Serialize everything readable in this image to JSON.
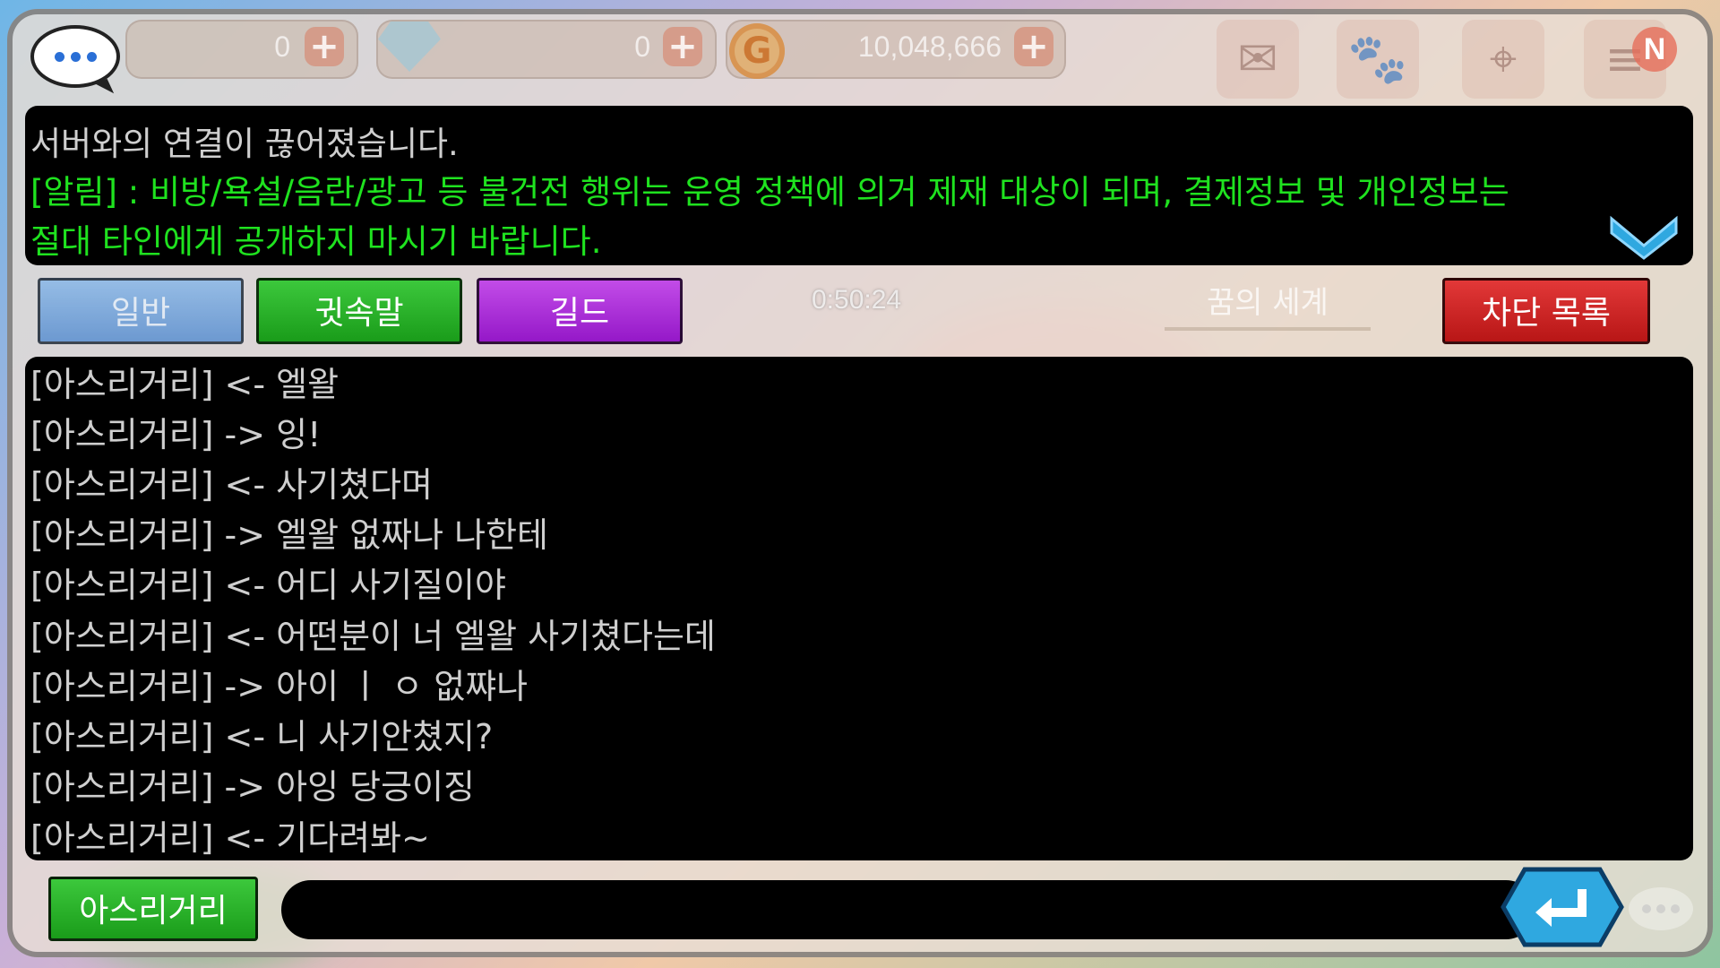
{
  "currency": {
    "slot1_value": "0",
    "slot2_value": "0",
    "gold_value": "10,048,666",
    "plus_glyph": "+",
    "coin_glyph": "G"
  },
  "top_icons": {
    "mail": "✉",
    "paw": "🐾",
    "map_pin": "⌖",
    "list": "≡",
    "new_badge": "N"
  },
  "notice": {
    "system_message": "서버와의 연결이 끊어졌습니다.",
    "warning_line1": "[알림] : 비방/욕설/음란/광고 등 불건전 행위는 운영 정책에 의거 제재 대상이 되며, 결제정보 및 개인정보는",
    "warning_line2": "절대 타인에게 공개하지 마시기 바랍니다."
  },
  "tabs": {
    "normal": "일반",
    "whisper": "귓속말",
    "guild": "길드"
  },
  "timer": "0:50:24",
  "world_label": "꿈의 세계",
  "block_list_label": "차단 목록",
  "chat_lines": [
    "[아스리거리] <- 엘왈",
    "[아스리거리] -> 잉!",
    "[아스리거리] <- 사기쳤다며",
    "[아스리거리] -> 엘왈 없짜나 나한테",
    "[아스리거리] <- 어디 사기질이야",
    "[아스리거리] <- 어떤분이 너 엘왈 사기쳤다는데",
    "[아스리거리] -> 아이 ㅣ ㅇ 없쨔나",
    "[아스리거리] <- 니 사기안쳤지?",
    "[아스리거리] -> 아잉 당긍이징",
    "[아스리거리] <- 기다려봐~"
  ],
  "input": {
    "target_name": "아스리거리",
    "value": ""
  },
  "colors": {
    "warning_text": "#1fe21f",
    "chat_text": "#cfcfcf",
    "whisper_tab": "#1a9c1a",
    "guild_tab": "#9518c8",
    "block_button": "#b81616",
    "send_button": "#2fa8e0"
  }
}
